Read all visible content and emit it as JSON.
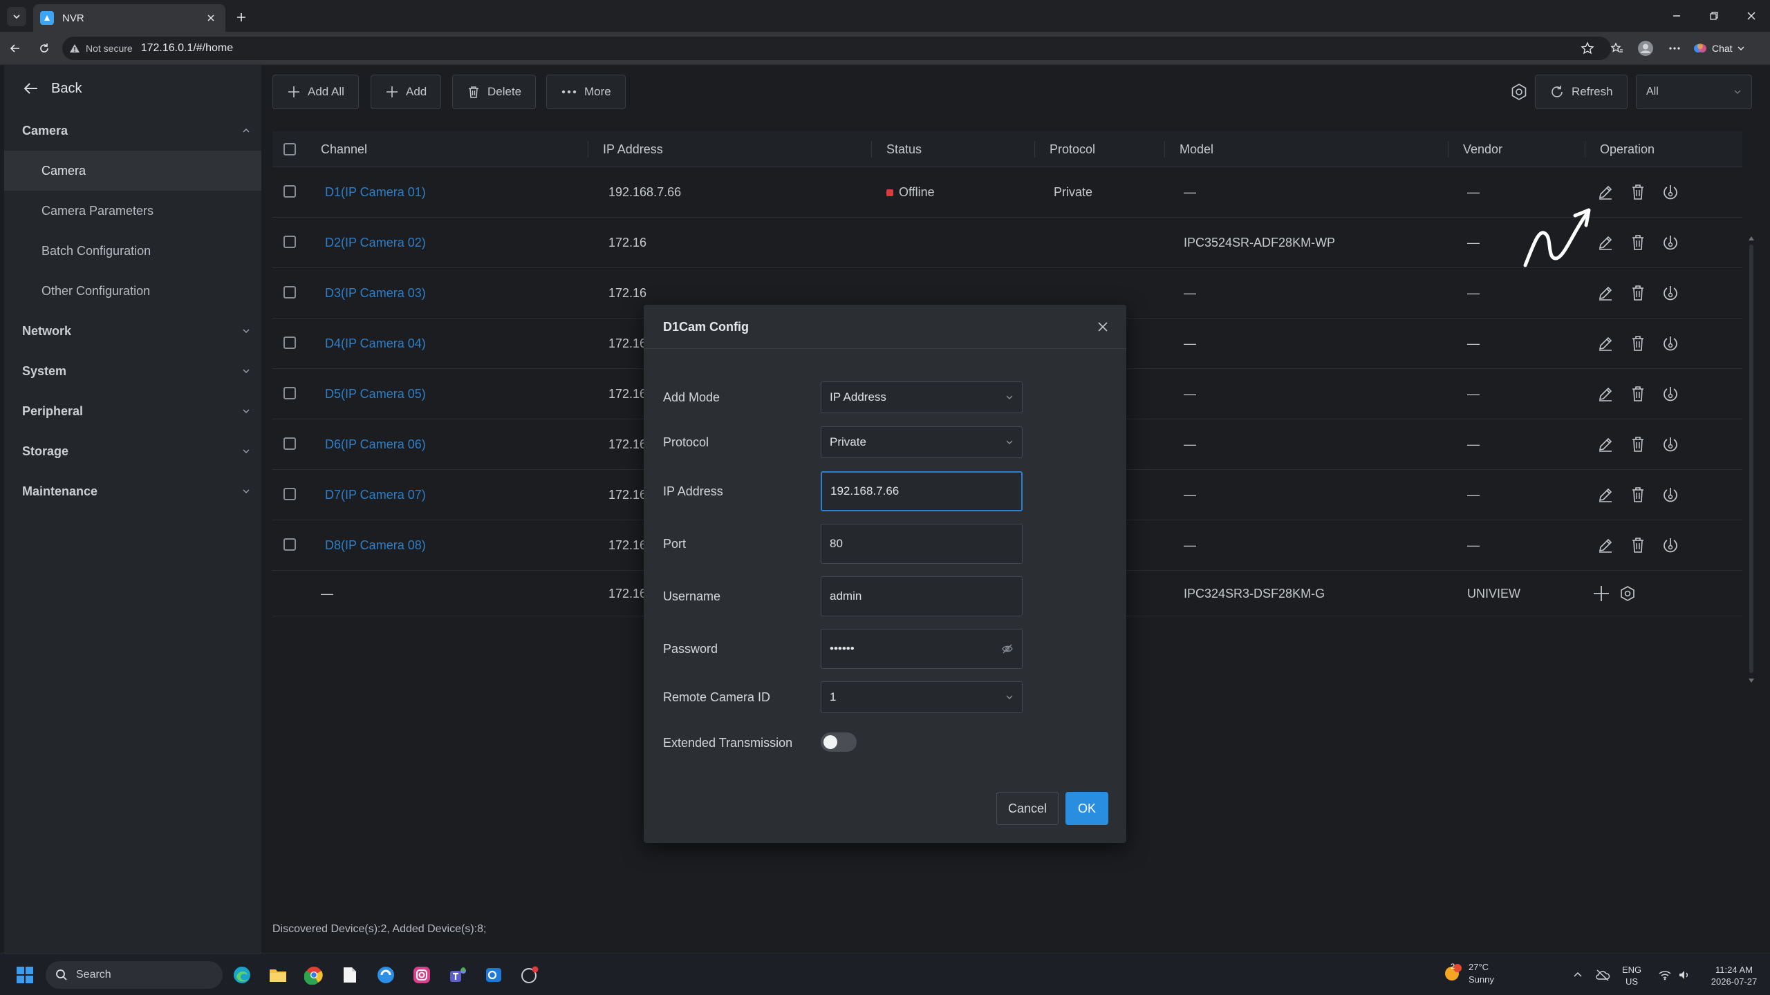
{
  "browser": {
    "tab_title": "NVR",
    "not_secure": "Not secure",
    "url": "172.16.0.1/#/home",
    "chat_label": "Chat"
  },
  "sidebar": {
    "back_label": "Back",
    "groups": [
      {
        "label": "Camera",
        "expanded": true,
        "items": [
          "Camera",
          "Camera Parameters",
          "Batch Configuration",
          "Other Configuration"
        ]
      },
      {
        "label": "Network"
      },
      {
        "label": "System"
      },
      {
        "label": "Peripheral"
      },
      {
        "label": "Storage"
      },
      {
        "label": "Maintenance"
      }
    ],
    "active_item": "Camera"
  },
  "toolbar": {
    "add_all": "Add All",
    "add": "Add",
    "delete": "Delete",
    "more": "More",
    "refresh": "Refresh",
    "filter_value": "All"
  },
  "table": {
    "headers": [
      "Channel",
      "IP Address",
      "Status",
      "Protocol",
      "Model",
      "Vendor",
      "Operation"
    ],
    "rows": [
      {
        "channel": "D1(IP Camera 01)",
        "ip": "192.168.7.66",
        "status": "Offline",
        "protocol": "Private",
        "model": "—",
        "vendor": "—"
      },
      {
        "channel": "D2(IP Camera 02)",
        "ip": "172.16",
        "status": "",
        "protocol": "",
        "model": "IPC3524SR-ADF28KM-WP",
        "vendor": "—"
      },
      {
        "channel": "D3(IP Camera 03)",
        "ip": "172.16",
        "status": "",
        "protocol": "",
        "model": "—",
        "vendor": "—"
      },
      {
        "channel": "D4(IP Camera 04)",
        "ip": "172.16",
        "status": "",
        "protocol": "",
        "model": "—",
        "vendor": "—"
      },
      {
        "channel": "D5(IP Camera 05)",
        "ip": "172.16",
        "status": "",
        "protocol": "",
        "model": "—",
        "vendor": "—"
      },
      {
        "channel": "D6(IP Camera 06)",
        "ip": "172.16",
        "status": "",
        "protocol": "",
        "model": "—",
        "vendor": "—"
      },
      {
        "channel": "D7(IP Camera 07)",
        "ip": "172.16",
        "status": "",
        "protocol": "",
        "model": "—",
        "vendor": "—"
      },
      {
        "channel": "D8(IP Camera 08)",
        "ip": "172.16",
        "status": "",
        "protocol": "",
        "model": "—",
        "vendor": "—"
      }
    ],
    "discovered_row": {
      "channel": "—",
      "ip": "172.16",
      "model": "IPC324SR3-DSF28KM-G",
      "vendor": "UNIVIEW"
    }
  },
  "footer": "Discovered Device(s):2, Added Device(s):8;",
  "modal": {
    "title": "D1Cam Config",
    "fields": {
      "add_mode_label": "Add Mode",
      "add_mode_value": "IP Address",
      "protocol_label": "Protocol",
      "protocol_value": "Private",
      "ip_label": "IP Address",
      "ip_value": "192.168.7.66",
      "port_label": "Port",
      "port_value": "80",
      "username_label": "Username",
      "username_value": "admin",
      "password_label": "Password",
      "password_value": "••••••",
      "remote_id_label": "Remote Camera ID",
      "remote_id_value": "1",
      "extended_label": "Extended Transmission"
    },
    "extended_on": false,
    "cancel": "Cancel",
    "ok": "OK"
  },
  "taskbar": {
    "search": "Search",
    "temp": "27°C",
    "weather": "Sunny",
    "weather_badge": "2",
    "lang1": "ENG",
    "lang2": "US",
    "time": "11:24 AM",
    "date": "2026-07-27"
  },
  "colors": {
    "accent": "#2a8ee0",
    "link": "#2f7fc8",
    "offline": "#e0383f"
  }
}
